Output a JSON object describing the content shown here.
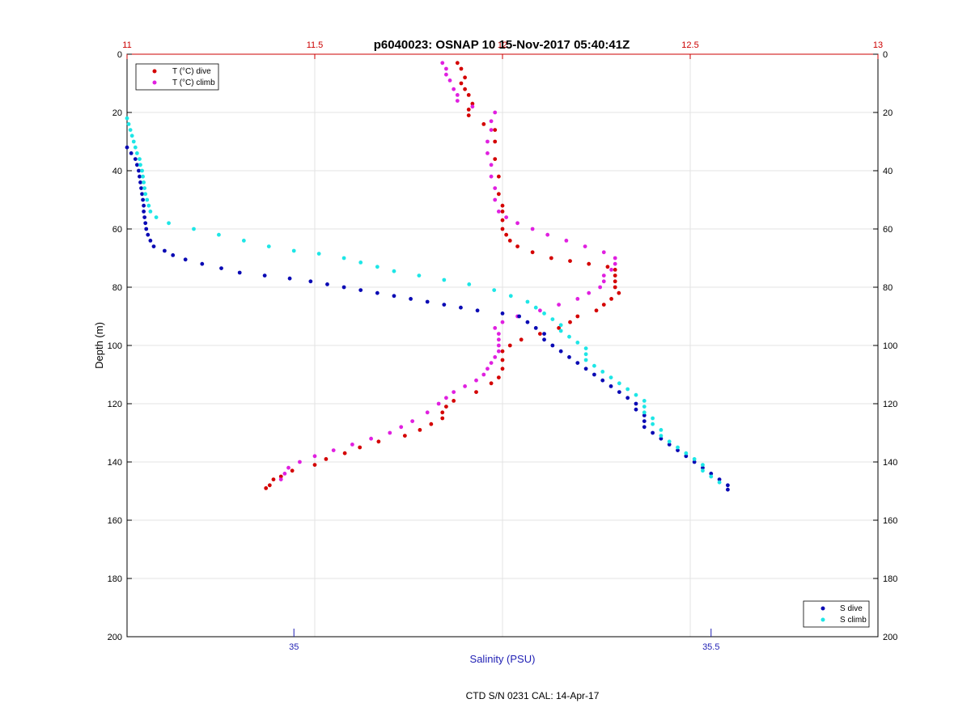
{
  "chart_data": {
    "type": "scatter",
    "title": "p6040023: OSNAP 10 15-Nov-2017 05:40:41Z",
    "footer": "CTD S/N 0231  CAL: 14-Apr-17",
    "ylabel": "Depth (m)",
    "xlabel_bottom": "Salinity (PSU)",
    "xlabel_top": "",
    "y_ticks": [
      "0",
      "20",
      "40",
      "60",
      "80",
      "100",
      "120",
      "140",
      "160",
      "180",
      "200"
    ],
    "ylim": [
      0,
      200
    ],
    "y_reversed": true,
    "x_top_ticks": [
      "11",
      "11.5",
      "12",
      "12.5",
      "13"
    ],
    "xlim_top": [
      11,
      13
    ],
    "x_bottom_ticks": [
      "35",
      "35.5"
    ],
    "xlim_bottom": [
      34.8,
      35.7
    ],
    "grid": true,
    "legend_top_left": [
      {
        "label": "T (°C) dive",
        "color": "#d40000"
      },
      {
        "label": "T (°C) climb",
        "color": "#e020e0"
      }
    ],
    "legend_bottom_right": [
      {
        "label": "S dive",
        "color": "#0a0ab4"
      },
      {
        "label": "S climb",
        "color": "#1ee6e6"
      }
    ],
    "series": [
      {
        "name": "T (°C) dive",
        "axis": "top",
        "color": "#d40000",
        "points": [
          [
            11.88,
            3
          ],
          [
            11.89,
            5
          ],
          [
            11.9,
            8
          ],
          [
            11.89,
            10
          ],
          [
            11.9,
            12
          ],
          [
            11.91,
            14
          ],
          [
            11.92,
            17
          ],
          [
            11.91,
            19
          ],
          [
            11.91,
            21
          ],
          [
            11.95,
            24
          ],
          [
            11.98,
            26
          ],
          [
            11.98,
            30
          ],
          [
            11.98,
            36
          ],
          [
            11.99,
            42
          ],
          [
            11.99,
            48
          ],
          [
            12,
            52
          ],
          [
            12,
            54
          ],
          [
            12,
            57
          ],
          [
            12,
            60
          ],
          [
            12.01,
            62
          ],
          [
            12.02,
            64
          ],
          [
            12.04,
            66
          ],
          [
            12.08,
            68
          ],
          [
            12.13,
            70
          ],
          [
            12.18,
            71
          ],
          [
            12.23,
            72
          ],
          [
            12.28,
            73
          ],
          [
            12.3,
            74
          ],
          [
            12.3,
            76
          ],
          [
            12.3,
            78
          ],
          [
            12.3,
            80
          ],
          [
            12.31,
            82
          ],
          [
            12.29,
            84
          ],
          [
            12.27,
            86
          ],
          [
            12.25,
            88
          ],
          [
            12.2,
            90
          ],
          [
            12.18,
            92
          ],
          [
            12.15,
            94
          ],
          [
            12.1,
            96
          ],
          [
            12.05,
            98
          ],
          [
            12.02,
            100
          ],
          [
            12,
            102
          ],
          [
            12,
            105
          ],
          [
            12,
            108
          ],
          [
            11.99,
            111
          ],
          [
            11.97,
            113
          ],
          [
            11.93,
            116
          ],
          [
            11.87,
            119
          ],
          [
            11.85,
            121
          ],
          [
            11.84,
            123
          ],
          [
            11.84,
            125
          ],
          [
            11.81,
            127
          ],
          [
            11.78,
            129
          ],
          [
            11.74,
            131
          ],
          [
            11.67,
            133
          ],
          [
            11.62,
            135
          ],
          [
            11.58,
            137
          ],
          [
            11.53,
            139
          ],
          [
            11.5,
            141
          ],
          [
            11.44,
            143
          ],
          [
            11.41,
            145
          ],
          [
            11.39,
            146
          ],
          [
            11.38,
            148
          ],
          [
            11.37,
            149
          ]
        ]
      },
      {
        "name": "T (°C) climb",
        "axis": "top",
        "color": "#e020e0",
        "points": [
          [
            11.84,
            3
          ],
          [
            11.85,
            5
          ],
          [
            11.85,
            7
          ],
          [
            11.86,
            9
          ],
          [
            11.87,
            12
          ],
          [
            11.88,
            14
          ],
          [
            11.88,
            16
          ],
          [
            11.92,
            18
          ],
          [
            11.98,
            20
          ],
          [
            11.97,
            23
          ],
          [
            11.97,
            26
          ],
          [
            11.96,
            30
          ],
          [
            11.96,
            34
          ],
          [
            11.97,
            38
          ],
          [
            11.97,
            42
          ],
          [
            11.98,
            46
          ],
          [
            11.98,
            50
          ],
          [
            11.99,
            54
          ],
          [
            12.01,
            56
          ],
          [
            12.04,
            58
          ],
          [
            12.08,
            60
          ],
          [
            12.12,
            62
          ],
          [
            12.17,
            64
          ],
          [
            12.22,
            66
          ],
          [
            12.27,
            68
          ],
          [
            12.3,
            70
          ],
          [
            12.3,
            72
          ],
          [
            12.29,
            74
          ],
          [
            12.27,
            76
          ],
          [
            12.27,
            78
          ],
          [
            12.26,
            80
          ],
          [
            12.23,
            82
          ],
          [
            12.2,
            84
          ],
          [
            12.15,
            86
          ],
          [
            12.1,
            88
          ],
          [
            12.04,
            90
          ],
          [
            12.0,
            92
          ],
          [
            11.98,
            94
          ],
          [
            11.99,
            96
          ],
          [
            11.99,
            98
          ],
          [
            11.99,
            100
          ],
          [
            11.99,
            102
          ],
          [
            11.98,
            104
          ],
          [
            11.97,
            106
          ],
          [
            11.96,
            108
          ],
          [
            11.95,
            110
          ],
          [
            11.93,
            112
          ],
          [
            11.9,
            114
          ],
          [
            11.87,
            116
          ],
          [
            11.85,
            118
          ],
          [
            11.83,
            120
          ],
          [
            11.8,
            123
          ],
          [
            11.76,
            126
          ],
          [
            11.73,
            128
          ],
          [
            11.7,
            130
          ],
          [
            11.65,
            132
          ],
          [
            11.6,
            134
          ],
          [
            11.55,
            136
          ],
          [
            11.5,
            138
          ],
          [
            11.46,
            140
          ],
          [
            11.43,
            142
          ],
          [
            11.42,
            144
          ],
          [
            11.41,
            146
          ]
        ]
      },
      {
        "name": "S dive",
        "axis": "bottom",
        "color": "#0a0ab4",
        "points": [
          [
            34.8,
            32
          ],
          [
            34.805,
            34
          ],
          [
            34.81,
            36
          ],
          [
            34.812,
            38
          ],
          [
            34.814,
            40
          ],
          [
            34.815,
            42
          ],
          [
            34.816,
            44
          ],
          [
            34.817,
            46
          ],
          [
            34.818,
            48
          ],
          [
            34.819,
            50
          ],
          [
            34.82,
            52
          ],
          [
            34.82,
            54
          ],
          [
            34.821,
            56
          ],
          [
            34.822,
            58
          ],
          [
            34.823,
            60
          ],
          [
            34.825,
            62
          ],
          [
            34.828,
            64
          ],
          [
            34.832,
            66
          ],
          [
            34.845,
            67.5
          ],
          [
            34.855,
            69
          ],
          [
            34.87,
            70.5
          ],
          [
            34.89,
            72
          ],
          [
            34.913,
            73.5
          ],
          [
            34.935,
            75
          ],
          [
            34.965,
            76
          ],
          [
            34.995,
            77
          ],
          [
            35.02,
            78
          ],
          [
            35.04,
            79
          ],
          [
            35.06,
            80
          ],
          [
            35.08,
            81
          ],
          [
            35.1,
            82
          ],
          [
            35.12,
            83
          ],
          [
            35.14,
            84
          ],
          [
            35.16,
            85
          ],
          [
            35.18,
            86
          ],
          [
            35.2,
            87
          ],
          [
            35.22,
            88
          ],
          [
            35.25,
            89
          ],
          [
            35.27,
            90
          ],
          [
            35.28,
            92
          ],
          [
            35.29,
            94
          ],
          [
            35.3,
            96
          ],
          [
            35.3,
            98
          ],
          [
            35.31,
            100
          ],
          [
            35.32,
            102
          ],
          [
            35.33,
            104
          ],
          [
            35.34,
            106
          ],
          [
            35.35,
            108
          ],
          [
            35.36,
            110
          ],
          [
            35.37,
            112
          ],
          [
            35.38,
            114
          ],
          [
            35.39,
            116
          ],
          [
            35.4,
            118
          ],
          [
            35.41,
            120
          ],
          [
            35.41,
            122
          ],
          [
            35.42,
            124
          ],
          [
            35.42,
            126
          ],
          [
            35.42,
            128
          ],
          [
            35.43,
            130
          ],
          [
            35.44,
            132
          ],
          [
            35.45,
            134
          ],
          [
            35.46,
            136
          ],
          [
            35.47,
            138
          ],
          [
            35.48,
            140
          ],
          [
            35.49,
            142
          ],
          [
            35.5,
            144
          ],
          [
            35.51,
            146
          ],
          [
            35.52,
            148
          ],
          [
            35.52,
            149.5
          ]
        ]
      },
      {
        "name": "S climb",
        "axis": "bottom",
        "color": "#1ee6e6",
        "points": [
          [
            34.8,
            22
          ],
          [
            34.802,
            24
          ],
          [
            34.804,
            26
          ],
          [
            34.806,
            28
          ],
          [
            34.808,
            30
          ],
          [
            34.81,
            32
          ],
          [
            34.812,
            34
          ],
          [
            34.815,
            36
          ],
          [
            34.816,
            38
          ],
          [
            34.818,
            40
          ],
          [
            34.819,
            42
          ],
          [
            34.82,
            44
          ],
          [
            34.821,
            46
          ],
          [
            34.822,
            48
          ],
          [
            34.824,
            50
          ],
          [
            34.826,
            52
          ],
          [
            34.828,
            54
          ],
          [
            34.835,
            56
          ],
          [
            34.85,
            58
          ],
          [
            34.88,
            60
          ],
          [
            34.91,
            62
          ],
          [
            34.94,
            64
          ],
          [
            34.97,
            66
          ],
          [
            35.0,
            67.5
          ],
          [
            35.03,
            68.5
          ],
          [
            35.06,
            70
          ],
          [
            35.08,
            71.5
          ],
          [
            35.1,
            73
          ],
          [
            35.12,
            74.5
          ],
          [
            35.15,
            76
          ],
          [
            35.18,
            77.5
          ],
          [
            35.21,
            79
          ],
          [
            35.24,
            81
          ],
          [
            35.26,
            83
          ],
          [
            35.28,
            85
          ],
          [
            35.29,
            87
          ],
          [
            35.3,
            89
          ],
          [
            35.31,
            91
          ],
          [
            35.32,
            93
          ],
          [
            35.32,
            95
          ],
          [
            35.33,
            97
          ],
          [
            35.34,
            99
          ],
          [
            35.35,
            101
          ],
          [
            35.35,
            103
          ],
          [
            35.35,
            105
          ],
          [
            35.36,
            107
          ],
          [
            35.37,
            109
          ],
          [
            35.38,
            111
          ],
          [
            35.39,
            113
          ],
          [
            35.4,
            115
          ],
          [
            35.41,
            117
          ],
          [
            35.42,
            119
          ],
          [
            35.42,
            121
          ],
          [
            35.42,
            123
          ],
          [
            35.43,
            125
          ],
          [
            35.43,
            127
          ],
          [
            35.44,
            129
          ],
          [
            35.44,
            131
          ],
          [
            35.45,
            133
          ],
          [
            35.46,
            135
          ],
          [
            35.47,
            137
          ],
          [
            35.48,
            139
          ],
          [
            35.49,
            141
          ],
          [
            35.49,
            143
          ],
          [
            35.5,
            145
          ],
          [
            35.51,
            147
          ]
        ]
      }
    ]
  }
}
